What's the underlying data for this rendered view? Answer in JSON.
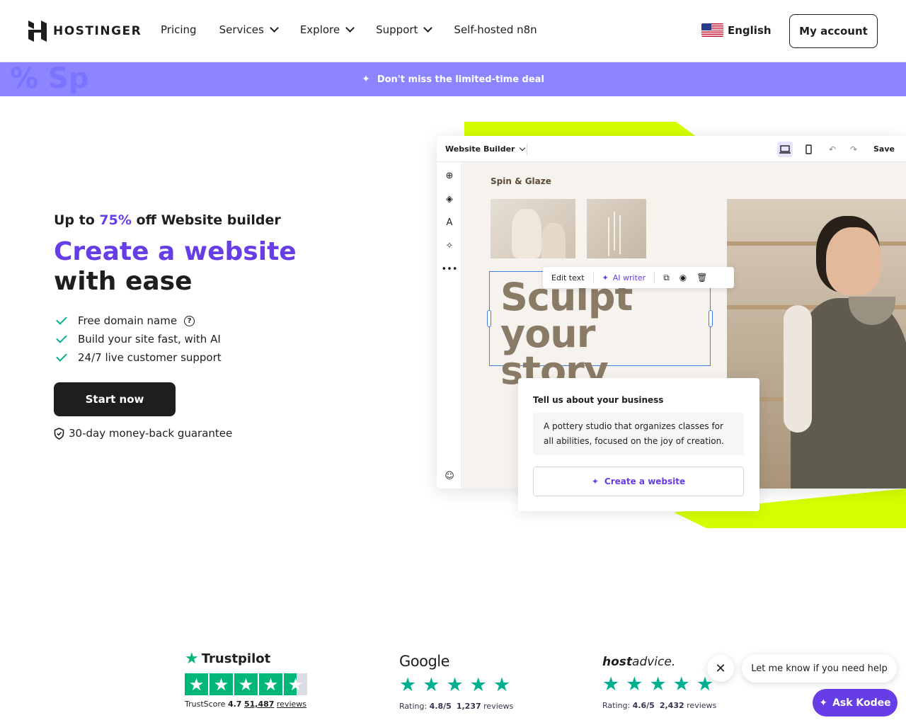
{
  "header": {
    "logo_text": "HOSTINGER",
    "nav": [
      {
        "label": "Pricing",
        "dropdown": false
      },
      {
        "label": "Services",
        "dropdown": true
      },
      {
        "label": "Explore",
        "dropdown": true
      },
      {
        "label": "Support",
        "dropdown": true
      },
      {
        "label": "Self-hosted n8n",
        "dropdown": false
      }
    ],
    "language": "English",
    "account_button": "My account"
  },
  "promo": {
    "text": "Don't miss the limited-time deal",
    "deco_text": "% Sp"
  },
  "hero": {
    "eyebrow_prefix": "Up to ",
    "eyebrow_discount": "75%",
    "eyebrow_suffix": " off Website builder",
    "headline_accent": "Create a website",
    "headline_rest": " with ease",
    "features": [
      "Free domain name",
      "Build your site fast, with AI",
      "24/7 live customer support"
    ],
    "cta": "Start now",
    "guarantee": "30-day money-back guarantee"
  },
  "builder": {
    "title": "Website Builder",
    "save": "Save",
    "site_name": "Spin & Glaze",
    "edit_text": "Edit text",
    "ai_writer": "AI writer",
    "headline": "Sculpt your story",
    "card_title": "Tell us about your business",
    "card_text": "A pottery studio that organizes classes for all abilities, focused on the joy of creation.",
    "card_button": "Create a website"
  },
  "reviews": {
    "trustpilot": {
      "name": "Trustpilot",
      "score_label": "TrustScore",
      "score": "4.7",
      "count": "51,487",
      "count_suffix": "reviews"
    },
    "google": {
      "name": "Google",
      "rating_label": "Rating:",
      "rating": "4.8/5",
      "count": "1,237",
      "count_suffix": "reviews"
    },
    "hostadvice": {
      "name_bold": "host",
      "name_rest": "advice.",
      "rating_label": "Rating:",
      "rating": "4.6/5",
      "count": "2,432",
      "count_suffix": "reviews"
    }
  },
  "chat": {
    "message": "Let me know if you need help",
    "close": "✕",
    "button": "Ask Kodee"
  },
  "colors": {
    "brand": "#673de6",
    "promo": "#8c85ff",
    "lime": "#d5ff00",
    "rating_green": "#00b67a"
  }
}
